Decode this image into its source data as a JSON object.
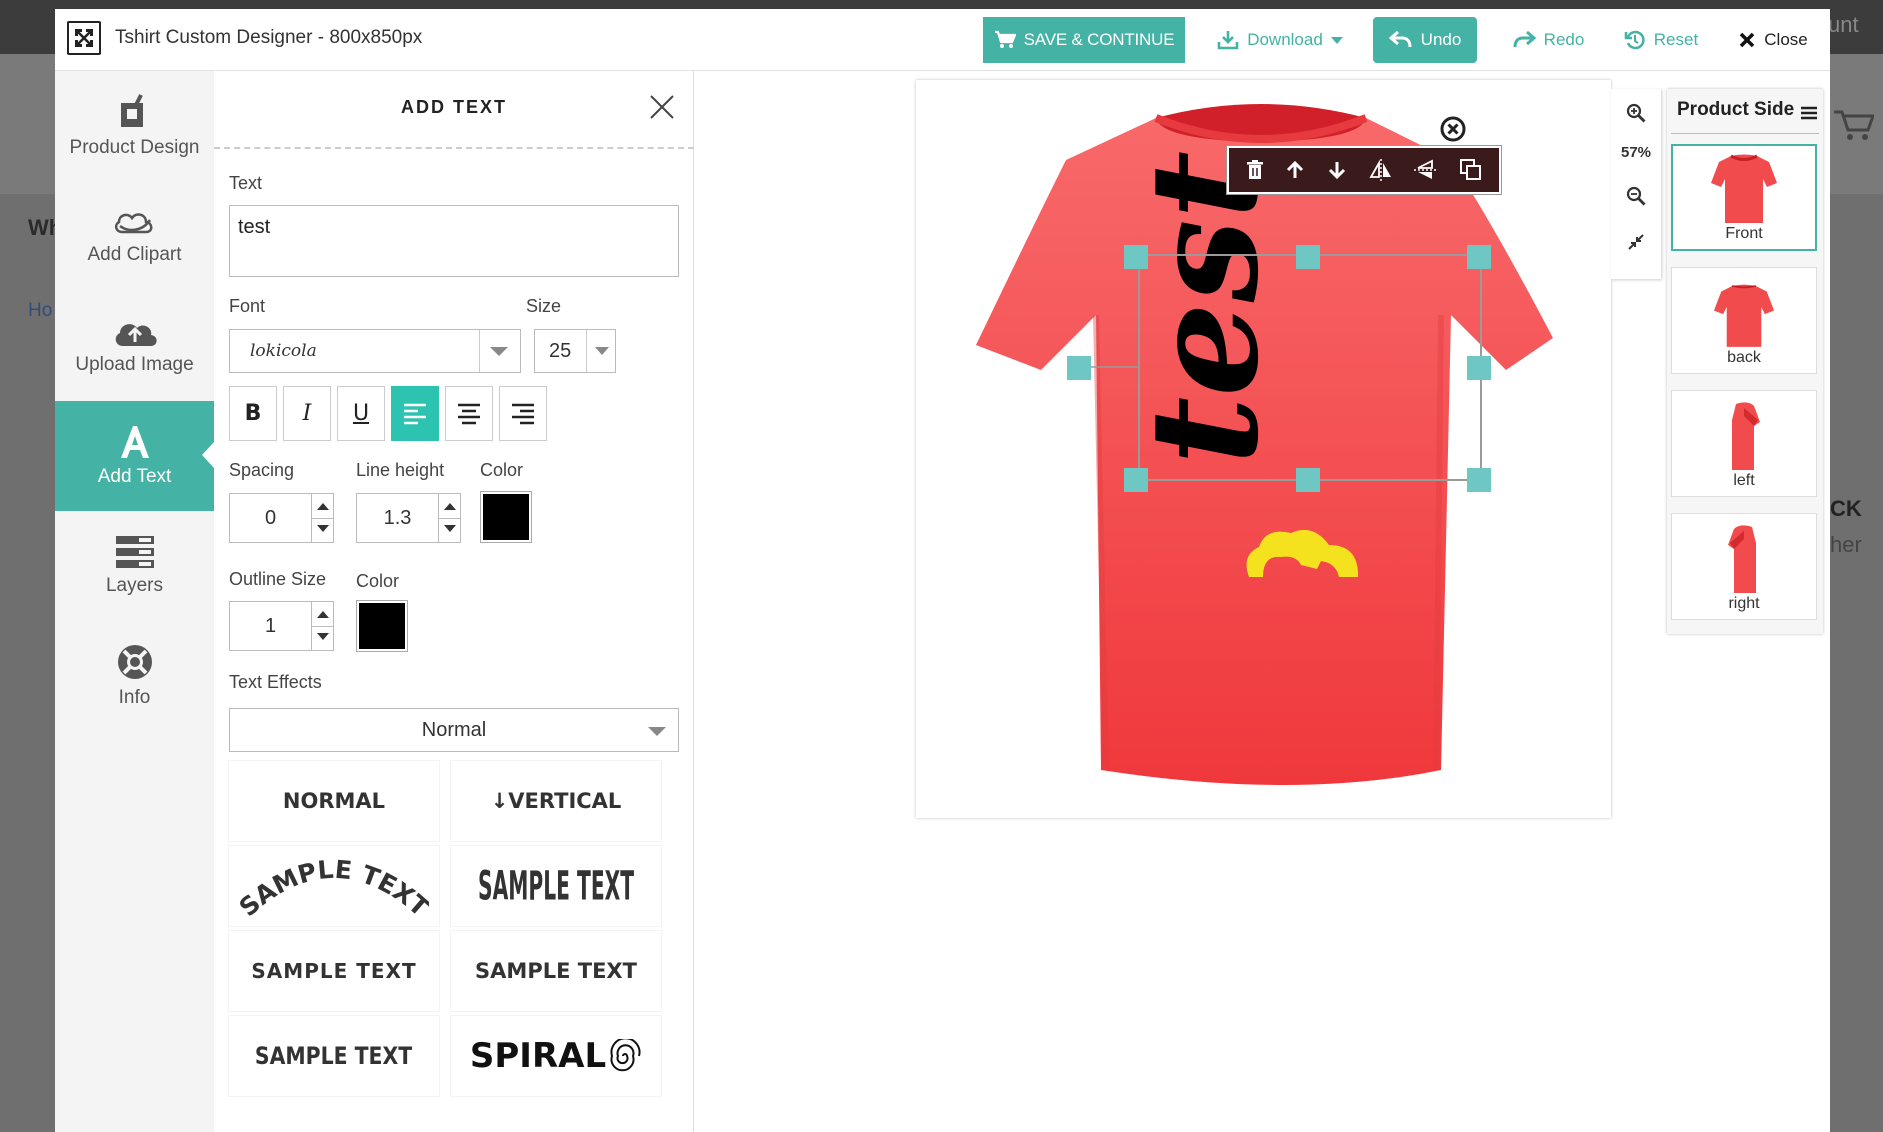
{
  "background": {
    "left_texts": [
      "Wh",
      "Ho"
    ],
    "right_texts": [
      "unt",
      "CK",
      "her"
    ]
  },
  "header": {
    "title": "Tshirt Custom Designer - 800x850px",
    "save_label": "SAVE & CONTINUE",
    "download_label": "Download",
    "undo_label": "Undo",
    "redo_label": "Redo",
    "reset_label": "Reset",
    "close_label": "Close"
  },
  "leftnav": {
    "items": [
      {
        "label": "Product Design",
        "icon": "product-design-icon"
      },
      {
        "label": "Add Clipart",
        "icon": "clipart-icon"
      },
      {
        "label": "Upload Image",
        "icon": "upload-cloud-icon"
      },
      {
        "label": "Add Text",
        "icon": "text-a-icon"
      },
      {
        "label": "Layers",
        "icon": "layers-icon"
      },
      {
        "label": "Info",
        "icon": "lifebuoy-icon"
      }
    ],
    "active": "Add Text"
  },
  "panel": {
    "title": "ADD TEXT",
    "text_label": "Text",
    "text_value": "test",
    "font_label": "Font",
    "font_value": "lokicola",
    "size_label": "Size",
    "size_value": "25",
    "format": {
      "bold": "B",
      "italic": "I",
      "underline": "U",
      "align": "left"
    },
    "spacing_label": "Spacing",
    "spacing_value": "0",
    "line_height_label": "Line height",
    "line_height_value": "1.3",
    "color_label": "Color",
    "color_value": "#000000",
    "outline_label": "Outline Size",
    "outline_value": "1",
    "outline_color_label": "Color",
    "outline_color_value": "#000000",
    "effects_label": "Text Effects",
    "effects_value": "Normal",
    "effects": [
      "NORMAL",
      "VERTICAL",
      "SAMPLE TEXT",
      "SAMPLE TEXT",
      "SAMPLE TEXT",
      "SAMPLE TEXT",
      "SAMPLE TEXT",
      "SPIRAL"
    ]
  },
  "canvas": {
    "design_text": "test",
    "shirt_color": "#f2484a",
    "zoom": "57%"
  },
  "product_side": {
    "title": "Product Side",
    "sides": [
      "Front",
      "back",
      "left",
      "right"
    ],
    "active": "Front"
  },
  "colors": {
    "accent": "#44b2a4",
    "active_format": "#2cc3b0",
    "clipart": "#f5e21f"
  }
}
